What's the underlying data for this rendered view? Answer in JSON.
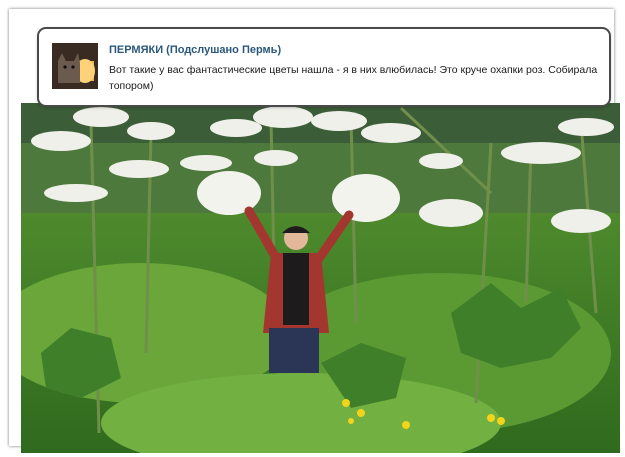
{
  "post": {
    "author": "ПЕРМЯКИ (Подслушано Пермь)",
    "text": "Вот такие у вас фантастические цветы нашла - я в них влюбилась! Это круче охапки роз. Собирала топором)"
  },
  "icons": {
    "avatar": "cat-with-lamp-avatar"
  },
  "colors": {
    "author_link": "#2b587a",
    "card_border": "#4a4a4a",
    "foliage": "#4f8f2f",
    "flower_umbel": "#f0f0ea"
  }
}
